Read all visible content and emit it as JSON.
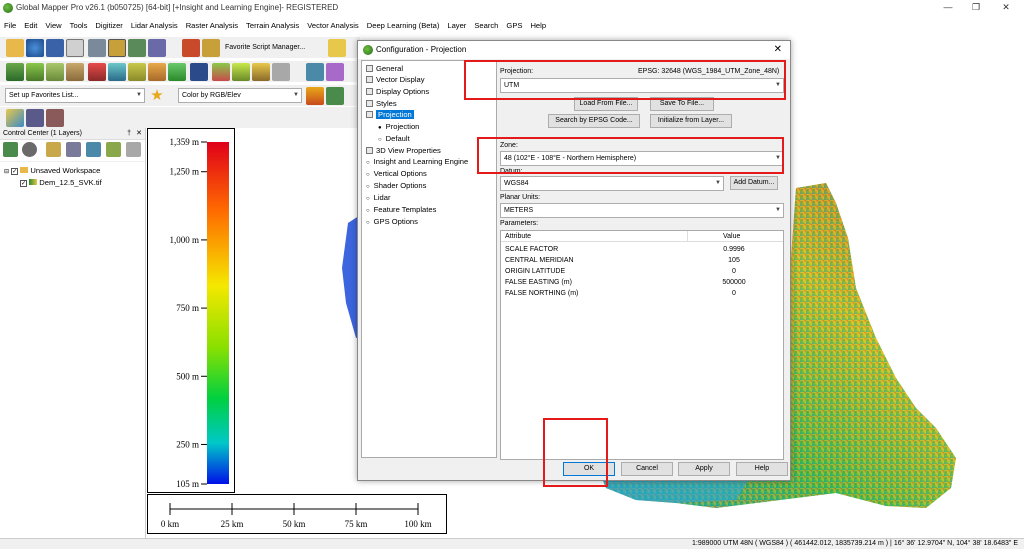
{
  "window": {
    "title": "Global Mapper Pro v26.1 (b050725) [64-bit] [+Insight and Learning Engine]- REGISTERED"
  },
  "menu": [
    "File",
    "Edit",
    "View",
    "Tools",
    "Digitizer",
    "Lidar Analysis",
    "Raster Analysis",
    "Terrain Analysis",
    "Vector Analysis",
    "Deep Learning (Beta)",
    "Layer",
    "Search",
    "GPS",
    "Help"
  ],
  "toolbar": {
    "favorite_script": "Favorite Script Manager...",
    "favorites_list": "Set up Favorites List...",
    "color_mode": "Color by RGB/Elev"
  },
  "control_center": {
    "title": "Control Center (1 Layers)",
    "workspace": "Unsaved Workspace",
    "layer": "Dem_12.5_SVK.tif"
  },
  "legend": {
    "labels": [
      "1,359 m",
      "1,250 m",
      "1,000 m",
      "750 m",
      "500 m",
      "250 m",
      "105 m"
    ],
    "values": [
      1359,
      1250,
      1000,
      750,
      500,
      250,
      105
    ],
    "range": [
      105,
      1359
    ]
  },
  "scalebar": {
    "labels": [
      "0 km",
      "25 km",
      "50 km",
      "75 km",
      "100 km"
    ]
  },
  "dialog": {
    "title": "Configuration - Projection",
    "tree": [
      {
        "label": "General",
        "level": 0
      },
      {
        "label": "Vector Display",
        "level": 0
      },
      {
        "label": "Display Options",
        "level": 0
      },
      {
        "label": "Styles",
        "level": 0
      },
      {
        "label": "Projection",
        "level": 0,
        "selected": true
      },
      {
        "label": "Projection",
        "level": 1
      },
      {
        "label": "Default",
        "level": 1
      },
      {
        "label": "3D View Properties",
        "level": 0
      },
      {
        "label": "Insight and Learning Engine",
        "level": 0
      },
      {
        "label": "Vertical Options",
        "level": 0
      },
      {
        "label": "Shader Options",
        "level": 0
      },
      {
        "label": "Lidar",
        "level": 0
      },
      {
        "label": "Feature Templates",
        "level": 0
      },
      {
        "label": "GPS Options",
        "level": 0
      }
    ],
    "projection_label": "Projection:",
    "epsg": "EPSG: 32648 (WGS_1984_UTM_Zone_48N)",
    "projection_value": "UTM",
    "load_btn": "Load From File...",
    "save_btn": "Save To File...",
    "search_epsg_btn": "Search by EPSG Code...",
    "init_layer_btn": "Initialize from Layer...",
    "zone_label": "Zone:",
    "zone_value": "48 (102°E - 108°E - Northern Hemisphere)",
    "datum_label": "Datum:",
    "datum_value": "WGS84",
    "add_datum_btn": "Add Datum...",
    "units_label": "Planar Units:",
    "units_value": "METERS",
    "params_label": "Parameters:",
    "param_headers": [
      "Attribute",
      "Value"
    ],
    "params": [
      [
        "SCALE FACTOR",
        "0.9996"
      ],
      [
        "CENTRAL MERIDIAN",
        "105"
      ],
      [
        "ORIGIN LATITUDE",
        "0"
      ],
      [
        "FALSE EASTING (m)",
        "500000"
      ],
      [
        "FALSE NORTHING (m)",
        "0"
      ]
    ],
    "ok": "OK",
    "cancel": "Cancel",
    "apply": "Apply",
    "help": "Help"
  },
  "status": "1:989000  UTM 48N ( WGS84 ) ( 461442.012, 1835739.214 m ) | 16° 36' 12.9704\" N, 104° 38' 18.6483\" E"
}
